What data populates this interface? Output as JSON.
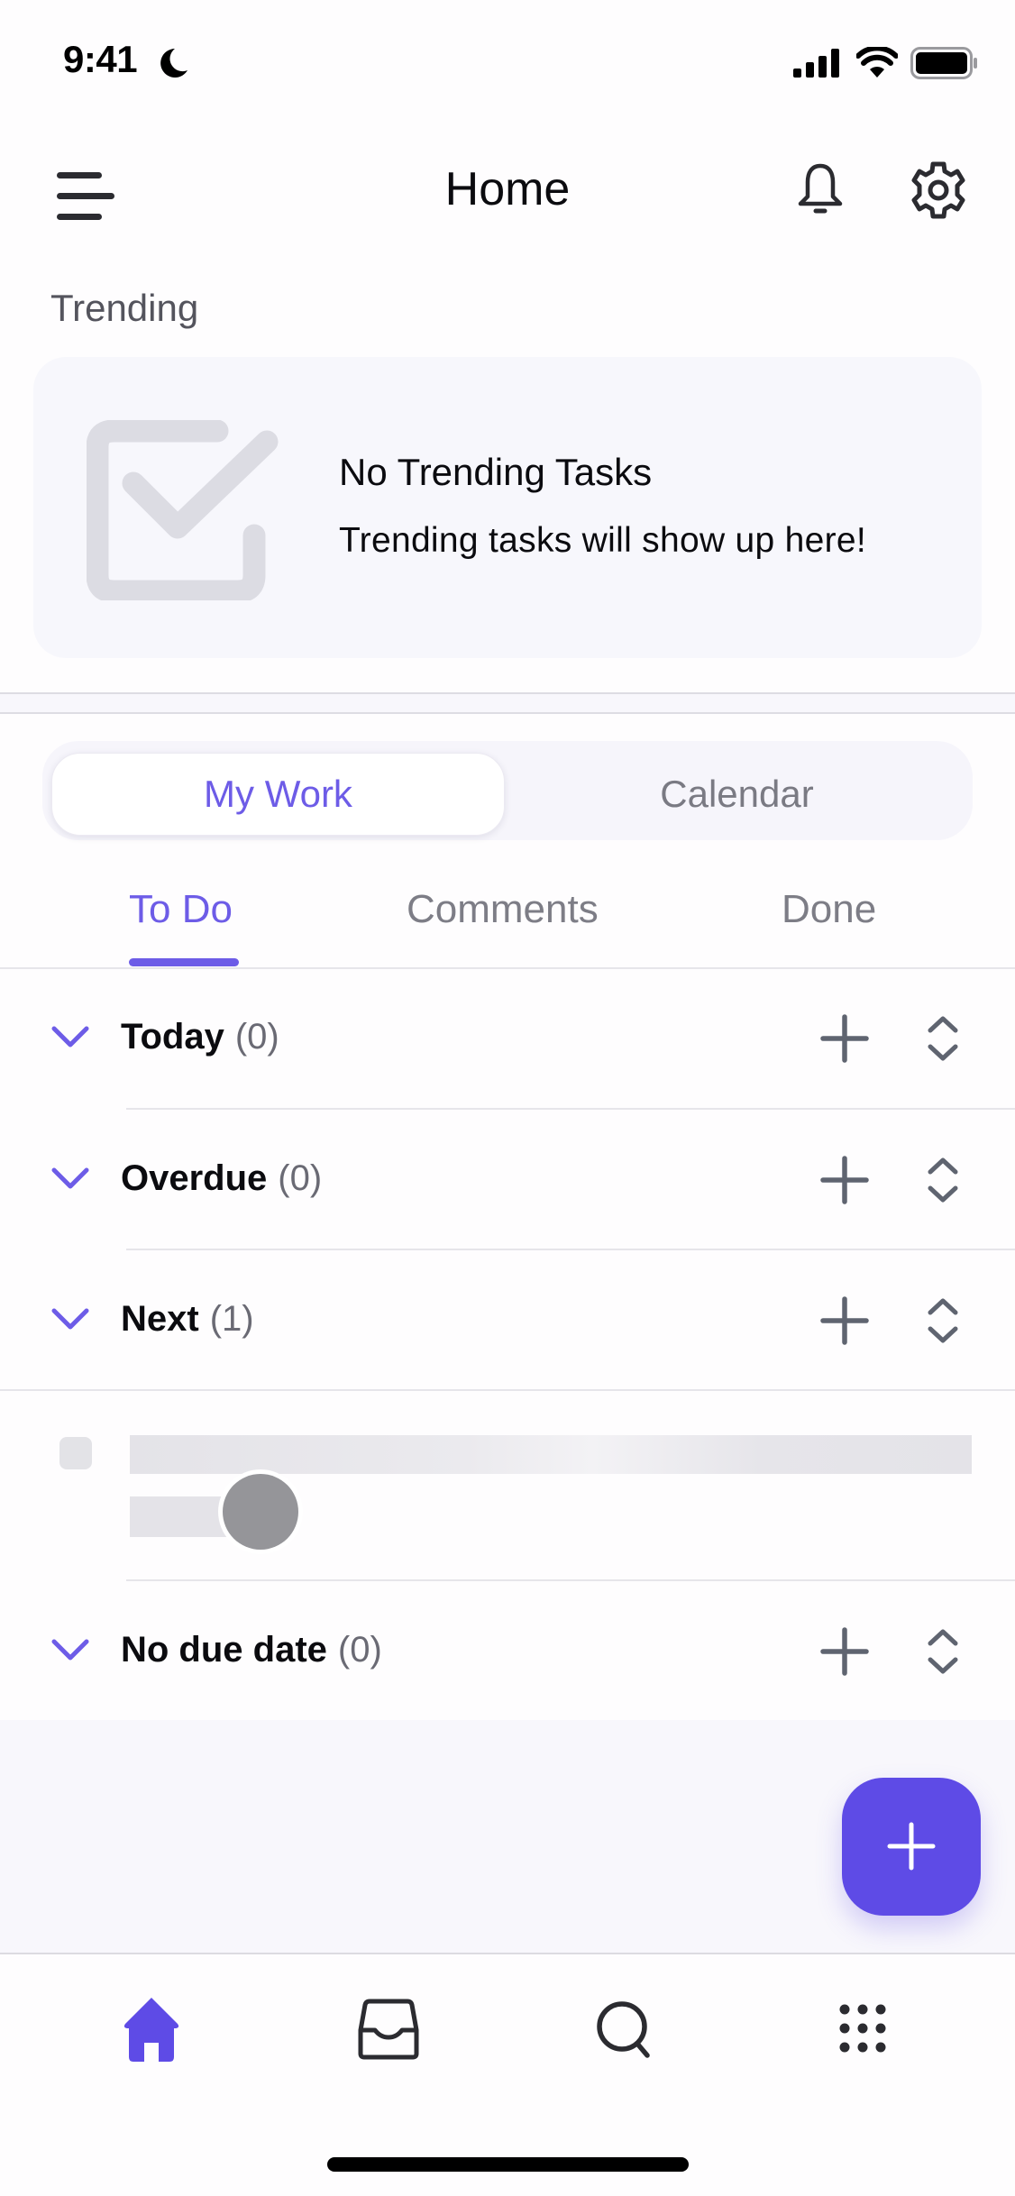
{
  "status_bar": {
    "time": "9:41",
    "focus_icon": "moon-icon",
    "signal_icon": "cellular-signal-icon",
    "wifi_icon": "wifi-icon",
    "battery_icon": "battery-icon"
  },
  "header": {
    "title": "Home",
    "menu_icon": "hamburger-menu-icon",
    "notifications_icon": "bell-icon",
    "settings_icon": "gear-icon"
  },
  "trending": {
    "label": "Trending",
    "empty_title": "No Trending Tasks",
    "empty_subtitle": "Trending tasks will show up here!",
    "icon": "checkbox-checked-icon"
  },
  "view_switch": {
    "options": [
      {
        "label": "My Work",
        "selected": true
      },
      {
        "label": "Calendar",
        "selected": false
      }
    ]
  },
  "tabs": [
    {
      "label": "To Do",
      "active": true
    },
    {
      "label": "Comments",
      "active": false
    },
    {
      "label": "Done",
      "active": false
    }
  ],
  "sections": [
    {
      "title": "Today",
      "count": "(0)",
      "expanded": true
    },
    {
      "title": "Overdue",
      "count": "(0)",
      "expanded": true
    },
    {
      "title": "Next",
      "count": "(1)",
      "expanded": true
    },
    {
      "title": "No due date",
      "count": "(0)",
      "expanded": true
    }
  ],
  "next_tasks": [
    {
      "state": "loading-placeholder"
    }
  ],
  "fab": {
    "icon": "plus-icon",
    "action": "add-task"
  },
  "bottom_nav": [
    {
      "name": "home",
      "icon": "home-icon",
      "active": true
    },
    {
      "name": "inbox",
      "icon": "inbox-icon",
      "active": false
    },
    {
      "name": "search",
      "icon": "search-icon",
      "active": false
    },
    {
      "name": "more",
      "icon": "grid-dots-icon",
      "active": false
    }
  ],
  "colors": {
    "accent": "#6d5ce7",
    "fab": "#5e4be6",
    "icon_gray": "#5f6470",
    "text_primary": "#0b0b0f",
    "text_secondary": "#7d7d86",
    "card_bg": "#f7f7fc"
  }
}
